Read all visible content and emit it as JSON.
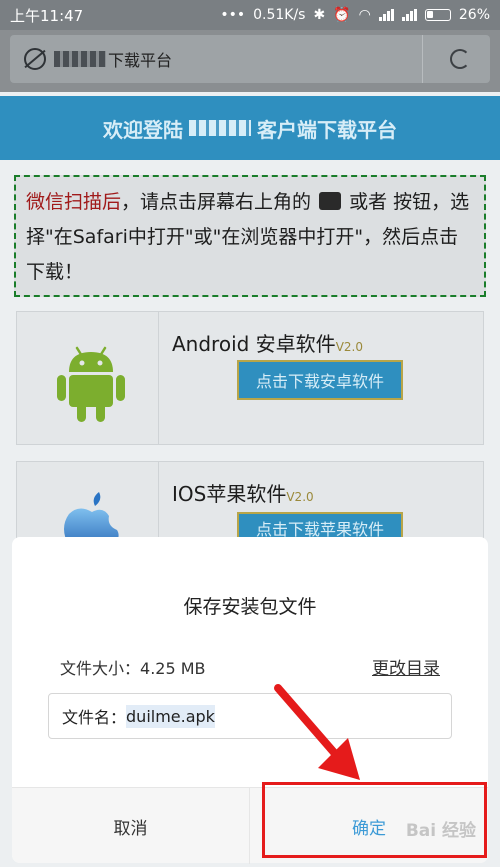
{
  "status_bar": {
    "time": "上午11:47",
    "speed": "0.51K/s",
    "battery": "26%"
  },
  "browser": {
    "url_suffix": "下载平台"
  },
  "page": {
    "banner_prefix": "欢迎登陆",
    "banner_suffix": "客户端下载平台",
    "notice_red": "微信扫描后",
    "notice_part1": "，请点击屏幕右上角的",
    "notice_part2": "或者 按钮，选择\"在Safari中打开\"或\"在浏览器中打开\"，然后点击下载！",
    "android_title": "Android 安卓软件",
    "android_version": "V2.0",
    "android_button": "点击下载安卓软件",
    "ios_title": "IOS苹果软件",
    "ios_version": "V2.0",
    "ios_button": "点击下载苹果软件"
  },
  "dialog": {
    "title": "保存安装包文件",
    "size_label": "文件大小：",
    "size_value": "4.25 MB",
    "change_dir": "更改目录",
    "name_label": "文件名：",
    "name_value": "duilme.apk",
    "cancel": "取消",
    "confirm": "确定"
  },
  "watermark": "Bai 经验",
  "colors": {
    "accent": "#2f8fbf",
    "confirm": "#3c9ad6",
    "annotation": "#e51b1b"
  }
}
